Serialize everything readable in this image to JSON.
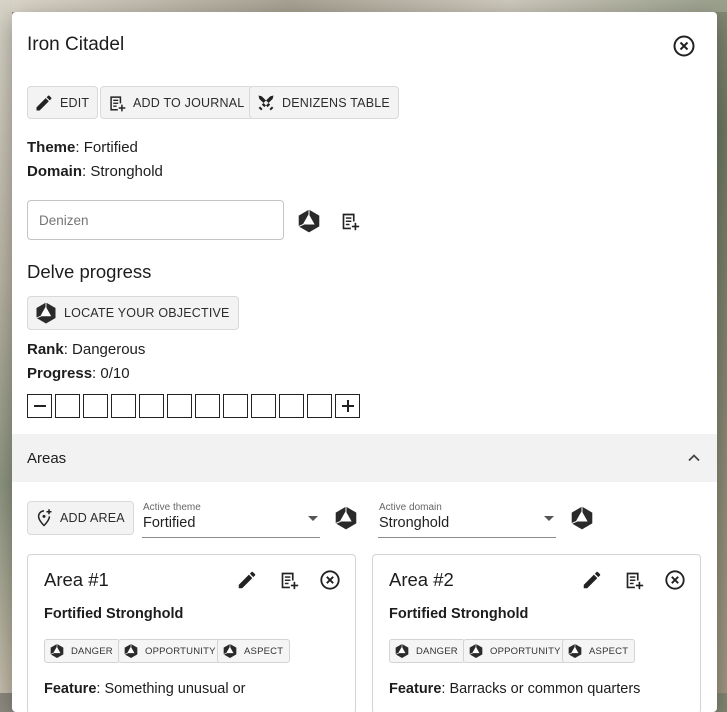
{
  "dialog": {
    "title": "Iron Citadel"
  },
  "toolbar": {
    "edit_label": "EDIT",
    "journal_label": "ADD TO JOURNAL",
    "denizens_label": "DENIZENS TABLE"
  },
  "site": {
    "theme_label": "Theme",
    "theme_value": ": Fortified",
    "domain_label": "Domain",
    "domain_value": ": Stronghold"
  },
  "denizen": {
    "placeholder": "Denizen"
  },
  "delve": {
    "heading": "Delve progress",
    "locate_label": "LOCATE YOUR OBJECTIVE",
    "rank_label": "Rank",
    "rank_value": ": Dangerous",
    "progress_label": "Progress",
    "progress_value": ": 0/10",
    "progress_filled": 0,
    "progress_total": 10
  },
  "areas": {
    "heading": "Areas",
    "add_label": "ADD AREA",
    "active_theme_label": "Active theme",
    "active_theme_value": "Fortified",
    "active_domain_label": "Active domain",
    "active_domain_value": "Stronghold",
    "cards": [
      {
        "title": "Area #1",
        "subtitle": "Fortified Stronghold",
        "chips": [
          "DANGER",
          "OPPORTUNITY",
          "ASPECT"
        ],
        "feature_label": "Feature",
        "feature_value": ": Something unusual or"
      },
      {
        "title": "Area #2",
        "subtitle": "Fortified Stronghold",
        "chips": [
          "DANGER",
          "OPPORTUNITY",
          "ASPECT"
        ],
        "feature_label": "Feature",
        "feature_value": ": Barracks or common quarters"
      }
    ]
  },
  "icons": {
    "close": "close-circle-icon",
    "edit": "pencil-icon",
    "journal": "journal-add-icon",
    "denizens": "crossed-swords-icon",
    "oracle": "d20-dice-icon",
    "add_area": "map-pin-add-icon",
    "collapse": "chevron-up-icon"
  }
}
